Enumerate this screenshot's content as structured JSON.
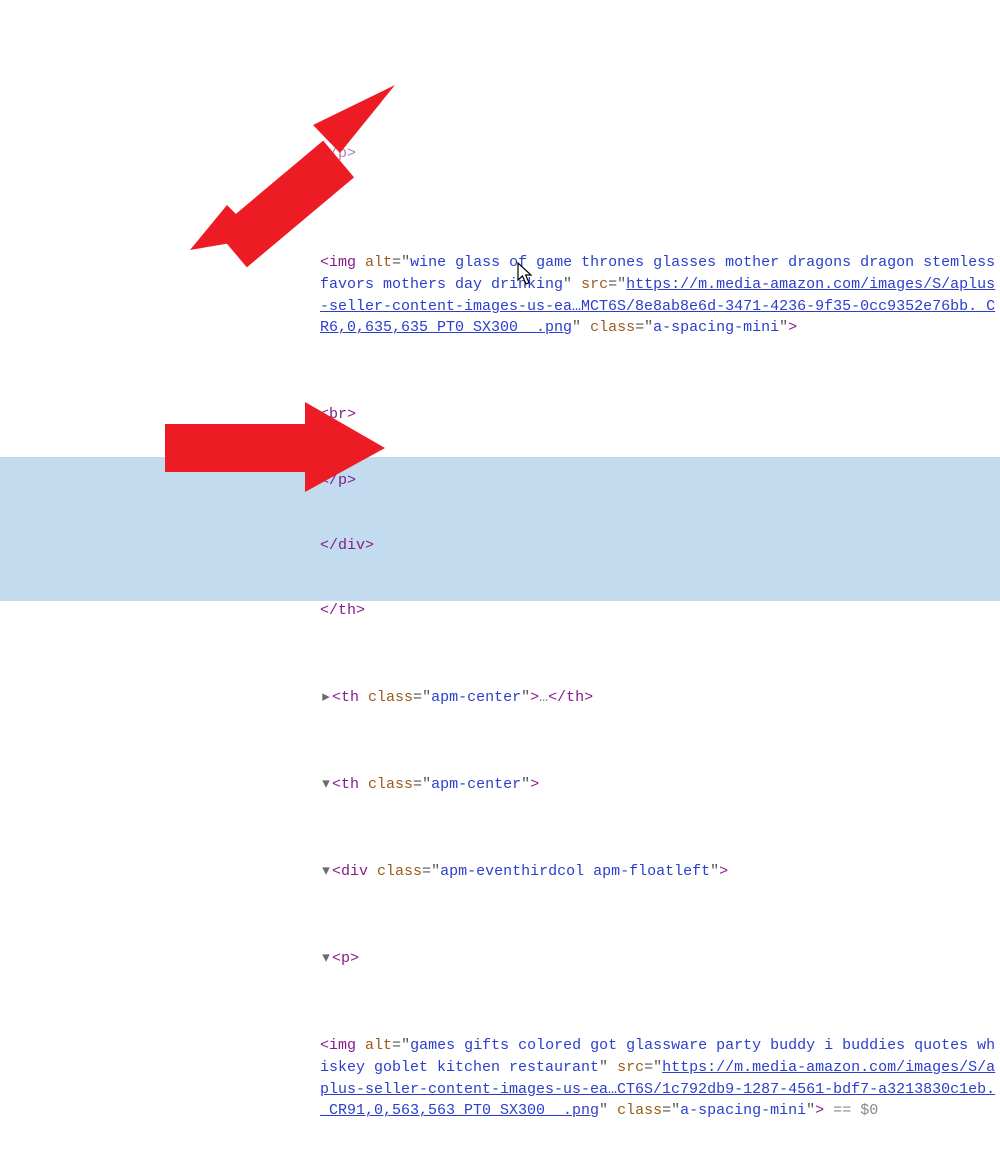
{
  "img1_alt": "wine glass of game thrones glasses mother dragons dragon stemless favors mothers day drinking",
  "img1_src": "https://m.media-amazon.com/images/S/aplus-seller-content-images-us-ea…MCT6S/8e8ab8e6d-3471-4236-9f35-0cc9352e76bb._CR6,0,635,635_PT0_SX300__.png",
  "img1_class": "a-spacing-mini",
  "th1_class": "apm-center",
  "th2_class": "apm-center",
  "div2_class": "apm-eventhirdcol apm-floatleft",
  "img2_alt": "games gifts colored got glassware party buddy i buddies quotes whiskey goblet kitchen restaurant",
  "img2_src": "https://m.media-amazon.com/images/S/aplus-seller-content-images-us-ea…CT6S/1c792db9-1287-4561-bdf7-a3213830c1eb._CR91,0,563,563_PT0_SX300__.png",
  "img2_class": "a-spacing-mini",
  "eqzero": "== $0"
}
